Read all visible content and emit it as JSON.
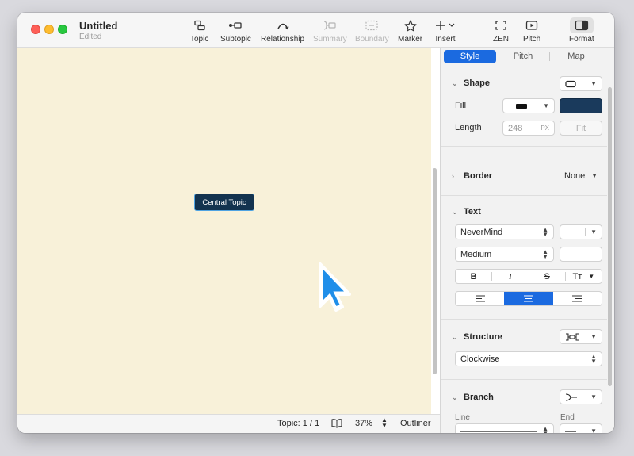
{
  "window": {
    "title": "Untitled",
    "subtitle": "Edited"
  },
  "toolbar": {
    "topic": "Topic",
    "subtopic": "Subtopic",
    "relationship": "Relationship",
    "summary": "Summary",
    "boundary": "Boundary",
    "marker": "Marker",
    "insert": "Insert",
    "zen": "ZEN",
    "pitch": "Pitch",
    "format": "Format"
  },
  "canvas": {
    "central_topic": "Central Topic",
    "background_color": "#f8f1d9"
  },
  "statusbar": {
    "topic_count": "Topic: 1 / 1",
    "zoom": "37%",
    "outliner": "Outliner"
  },
  "panel": {
    "tabs": [
      "Style",
      "Pitch",
      "Map"
    ],
    "active_tab": "Style",
    "shape": {
      "title": "Shape",
      "fill_label": "Fill",
      "fill_color": "#1a3a5c",
      "length_label": "Length",
      "length_placeholder": "248",
      "length_unit": "PX",
      "fit_label": "Fit"
    },
    "border": {
      "title": "Border",
      "value": "None"
    },
    "text": {
      "title": "Text",
      "font": "NeverMind",
      "weight": "Medium",
      "bold": "B",
      "italic": "I",
      "strike": "S",
      "case": "Tт"
    },
    "structure": {
      "title": "Structure",
      "direction": "Clockwise"
    },
    "branch": {
      "title": "Branch",
      "line_label": "Line",
      "end_label": "End"
    }
  },
  "colors": {
    "accent": "#1b6ae0",
    "topic_fill": "#13334f",
    "topic_border": "#4fa3e2"
  }
}
